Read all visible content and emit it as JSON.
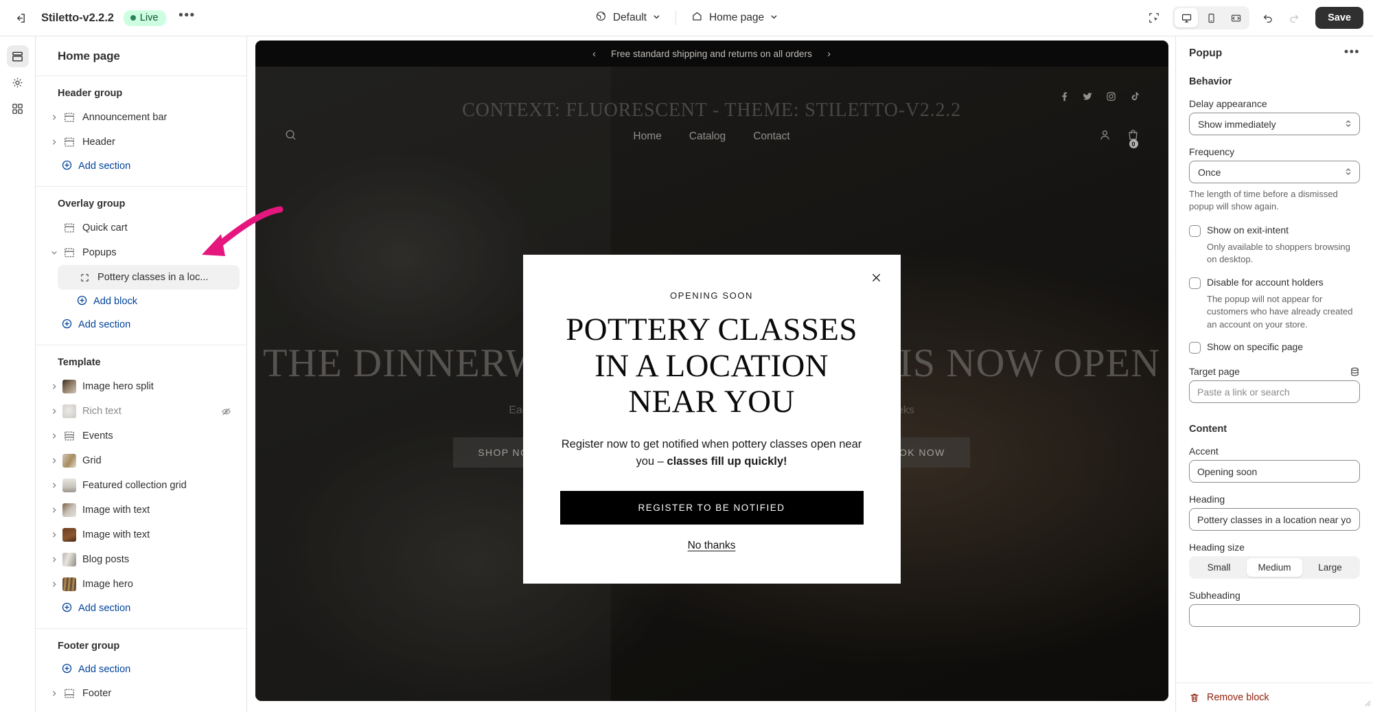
{
  "topbar": {
    "exit_icon": "exit-icon",
    "theme_name": "Stiletto-v2.2.2",
    "status_badge": "Live",
    "more_menu": "•••",
    "market_selector": {
      "icon": "globe-icon",
      "label": "Default",
      "chevron": "chevron-down-icon"
    },
    "page_selector": {
      "icon": "home-icon",
      "label": "Home page",
      "chevron": "chevron-down-icon"
    },
    "inspect_icon": "inspector-icon",
    "devices": [
      {
        "name": "desktop",
        "icon": "desktop-icon",
        "active": true
      },
      {
        "name": "mobile",
        "icon": "mobile-icon",
        "active": false
      },
      {
        "name": "fullscreen",
        "icon": "fullscreen-icon",
        "active": false
      }
    ],
    "undo_icon": "undo-icon",
    "redo_icon": "redo-icon",
    "save_label": "Save"
  },
  "rail": {
    "items": [
      {
        "name": "sections",
        "icon": "sections-icon",
        "active": true
      },
      {
        "name": "settings",
        "icon": "gear-icon",
        "active": false
      },
      {
        "name": "apps",
        "icon": "apps-icon",
        "active": false
      }
    ]
  },
  "sidebar": {
    "title": "Home page",
    "groups": [
      {
        "label": "Header group",
        "rows": [
          {
            "label": "Announcement bar",
            "icon": "section-icon",
            "caret": true
          },
          {
            "label": "Header",
            "icon": "section-icon",
            "caret": true
          }
        ],
        "add": "Add section"
      },
      {
        "label": "Overlay group",
        "rows": [
          {
            "label": "Quick cart",
            "icon": "section-icon",
            "caret": false
          },
          {
            "label": "Popups",
            "icon": "section-icon",
            "caret": true,
            "expanded": true
          }
        ],
        "nested": [
          {
            "label": "Pottery classes in a loc...",
            "icon": "block-icon",
            "selected": true
          }
        ],
        "add_block": "Add block",
        "add": "Add section"
      },
      {
        "label": "Template",
        "rows": [
          {
            "label": "Image hero split",
            "thumb": "image-thumb",
            "caret": true
          },
          {
            "label": "Rich text",
            "thumb": "image-thumb",
            "caret": true,
            "hidden": true
          },
          {
            "label": "Events",
            "icon": "section-icon",
            "caret": true
          },
          {
            "label": "Grid",
            "thumb": "image-thumb",
            "caret": true
          },
          {
            "label": "Featured collection grid",
            "thumb": "image-thumb",
            "caret": true
          },
          {
            "label": "Image with text",
            "thumb": "image-thumb",
            "caret": true
          },
          {
            "label": "Image with text",
            "thumb": "image-thumb",
            "caret": true
          },
          {
            "label": "Blog posts",
            "thumb": "image-thumb",
            "caret": true
          },
          {
            "label": "Image hero",
            "thumb": "image-thumb",
            "caret": true
          }
        ],
        "add": "Add section"
      },
      {
        "label": "Footer group",
        "rows": [
          {
            "label": "Footer",
            "icon": "section-icon",
            "caret": true
          }
        ],
        "add": "Add section"
      }
    ]
  },
  "preview": {
    "announcement": {
      "prev_icon": "chevron-left-icon",
      "text": "Free standard shipping and returns on all orders",
      "next_icon": "chevron-right-icon"
    },
    "context_label": "CONTEXT: FLUORESCENT - THEME: STILETTO-V2.2.2",
    "search_icon": "search-icon",
    "nav_links": [
      "Home",
      "Catalog",
      "Contact"
    ],
    "account_icon": "account-icon",
    "cart_icon": "cart-icon",
    "cart_count": "0",
    "socials": [
      "facebook-icon",
      "twitter-icon",
      "instagram-icon",
      "tiktok-icon"
    ],
    "hero_heading": "THE DINNERWARE COLLECTION IS NOW OPEN",
    "hero_sub": "Each piece is made by hand on the wheel with each course running for eight weeks",
    "hero_btn_left": "SHOP NOW",
    "hero_btn_right": "BOOK NOW",
    "modal": {
      "close_icon": "close-icon",
      "accent": "OPENING SOON",
      "heading": "POTTERY CLASSES IN A LOCATION NEAR YOU",
      "body_prefix": "Register now to get notified when pottery classes open near you – ",
      "body_strong": "classes fill up quickly!",
      "cta": "REGISTER TO BE NOTIFIED",
      "decline": "No thanks"
    }
  },
  "annotation": {
    "arrow_color": "#e5177f"
  },
  "rpanel": {
    "title": "Popup",
    "more_icon": "•••",
    "behavior": {
      "section_title": "Behavior",
      "delay_label": "Delay appearance",
      "delay_value": "Show immediately",
      "frequency_label": "Frequency",
      "frequency_value": "Once",
      "frequency_help": "The length of time before a dismissed popup will show again.",
      "exit_intent_label": "Show on exit-intent",
      "exit_intent_checked": false,
      "exit_intent_help": "Only available to shoppers browsing on desktop.",
      "disable_accounts_label": "Disable for account holders",
      "disable_accounts_checked": false,
      "disable_accounts_help": "The popup will not appear for customers who have already created an account on your store.",
      "specific_page_label": "Show on specific page",
      "specific_page_checked": false,
      "target_page_label": "Target page",
      "target_page_icon": "database-icon",
      "target_page_placeholder": "Paste a link or search",
      "target_page_value": ""
    },
    "content": {
      "section_title": "Content",
      "accent_label": "Accent",
      "accent_value": "Opening soon",
      "heading_label": "Heading",
      "heading_value": "Pottery classes in a location near you",
      "heading_size_label": "Heading size",
      "heading_size_options": [
        "Small",
        "Medium",
        "Large"
      ],
      "heading_size_selected": "Medium",
      "subheading_label": "Subheading",
      "subheading_value": ""
    },
    "remove_label": "Remove block",
    "remove_icon": "trash-icon"
  }
}
